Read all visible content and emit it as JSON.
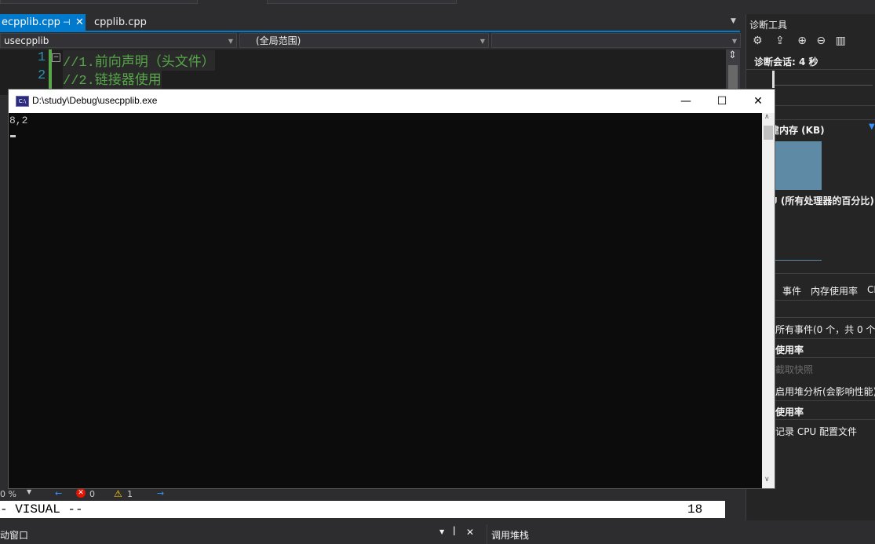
{
  "editor": {
    "tabs": [
      {
        "label": "ecpplib.cpp",
        "active": true
      },
      {
        "label": "cpplib.cpp",
        "active": false
      }
    ],
    "nav": {
      "project": "usecpplib",
      "scope": "(全局范围)",
      "member": ""
    },
    "code_lines": [
      {
        "num": "1",
        "text": "//1.前向声明（头文件）"
      },
      {
        "num": "2",
        "text": "//2.链接器使用"
      }
    ],
    "status": {
      "zoom": "0 %",
      "errors": "0",
      "warnings": "1"
    },
    "visual_mode": "- VISUAL --",
    "line_number": "18",
    "bottom_left": "动窗口",
    "bottom_right": "调用堆栈"
  },
  "diagnostics": {
    "title": "诊断工具",
    "session": "诊断会话: 4 秒",
    "memory_header": "建内存 (KB)",
    "cpu_header": "U (所有处理器的百分比)",
    "tabs": [
      "事件",
      "内存使用率",
      "CI"
    ],
    "all_events": "所有事件(0 个，共 0 个)",
    "memory_usage": "使用率",
    "snapshot": "截取快照",
    "heap_profiling": "启用堆分析(会影响性能)",
    "cpu_usage": "使用率",
    "record_cpu": "记录 CPU 配置文件"
  },
  "console": {
    "title": "D:\\study\\Debug\\usecpplib.exe",
    "icon_text": "C:\\",
    "output": "8,2",
    "minimize": "—",
    "maximize": "☐",
    "close": "✕"
  },
  "colors": {
    "accent": "#007acc",
    "comment": "#57a64a",
    "line_number": "#2b91af",
    "console_bg": "#0c0c0c"
  }
}
